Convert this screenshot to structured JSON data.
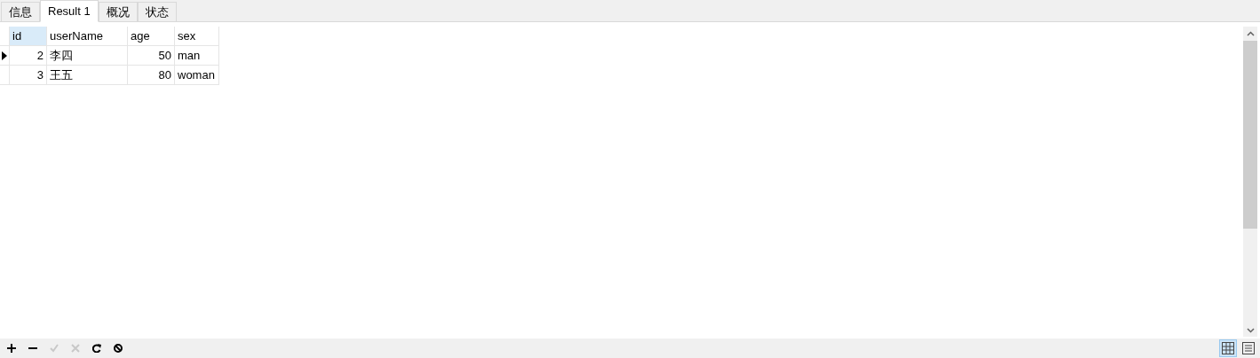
{
  "tabs": [
    {
      "label": "信息",
      "selected": false
    },
    {
      "label": "Result 1",
      "selected": true
    },
    {
      "label": "概况",
      "selected": false
    },
    {
      "label": "状态",
      "selected": false
    }
  ],
  "table": {
    "columns": [
      {
        "label": "id",
        "selected": true,
        "kind": "number"
      },
      {
        "label": "userName",
        "selected": false,
        "kind": "text"
      },
      {
        "label": "age",
        "selected": false,
        "kind": "number"
      },
      {
        "label": "sex",
        "selected": false,
        "kind": "text"
      }
    ],
    "rows": [
      {
        "current": true,
        "cells": [
          "2",
          "李四",
          "50",
          "man"
        ]
      },
      {
        "current": false,
        "cells": [
          "3",
          "王五",
          "80",
          "woman"
        ]
      }
    ]
  },
  "toolbar": [
    {
      "kind": "add",
      "disabled": false
    },
    {
      "kind": "remove",
      "disabled": false
    },
    {
      "kind": "apply",
      "disabled": true
    },
    {
      "kind": "cancel",
      "disabled": true
    },
    {
      "kind": "refresh",
      "disabled": false
    },
    {
      "kind": "stop",
      "disabled": false
    }
  ],
  "views": [
    {
      "kind": "grid",
      "selected": true
    },
    {
      "kind": "form",
      "selected": false
    }
  ]
}
